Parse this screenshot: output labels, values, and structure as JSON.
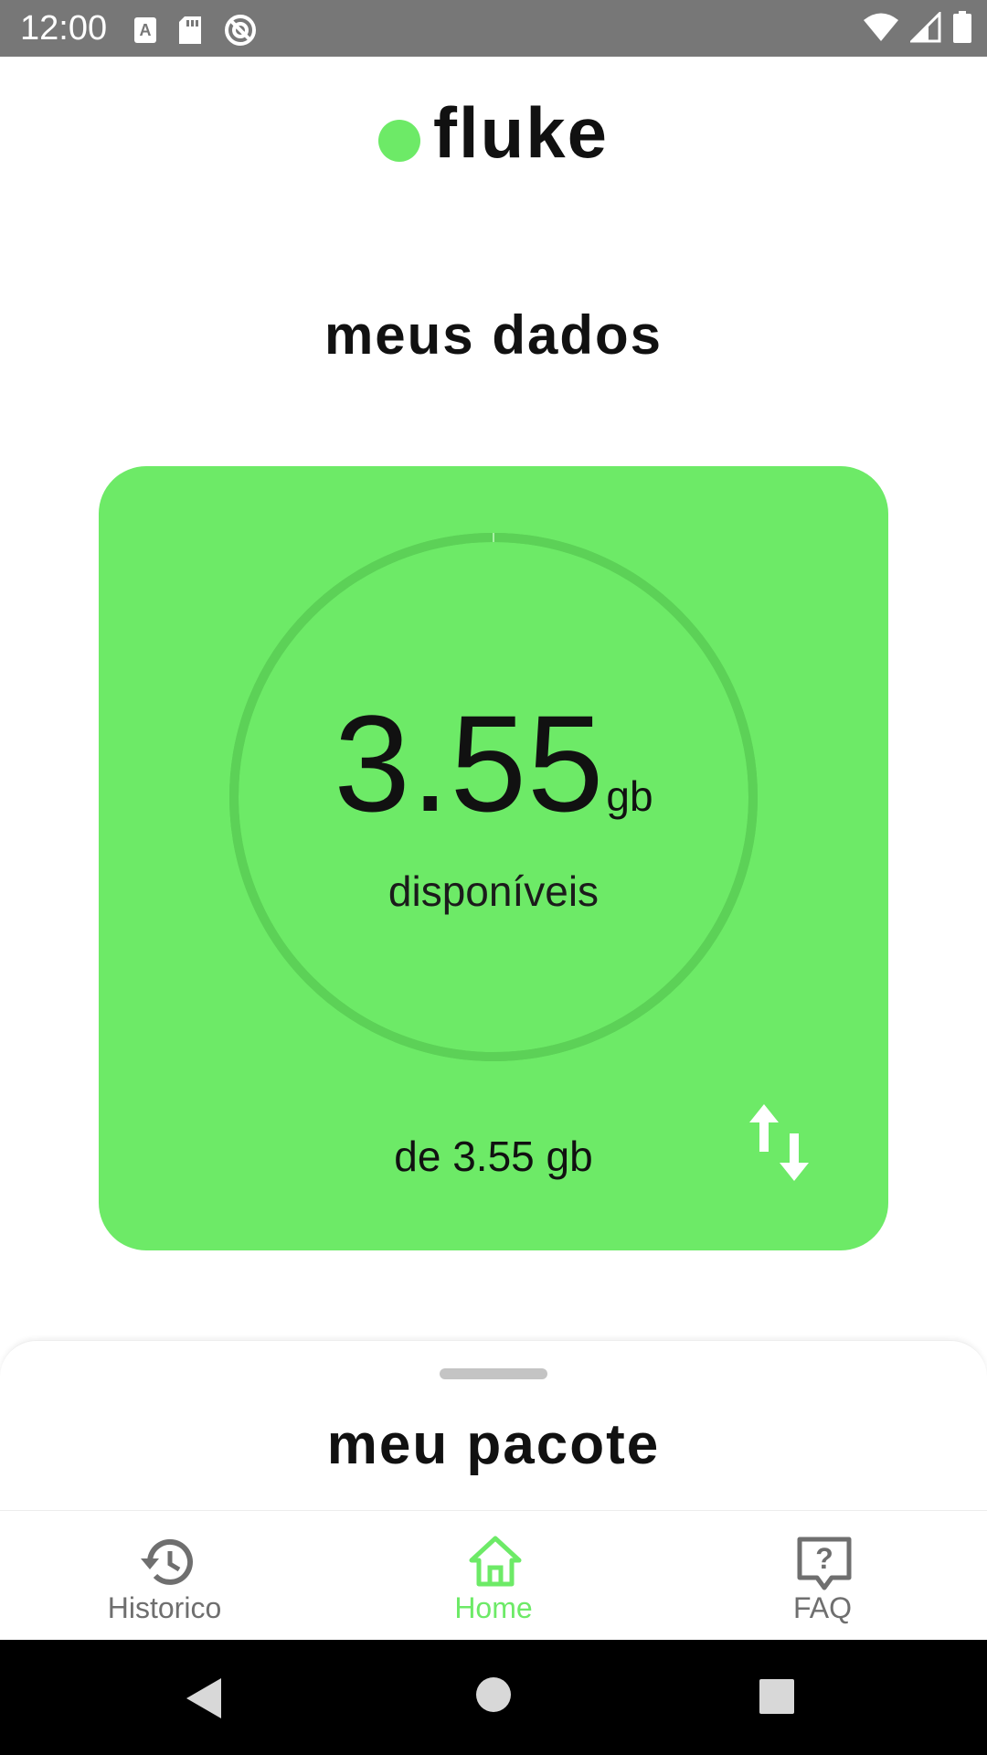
{
  "status_bar": {
    "time": "12:00",
    "icons": [
      "keyboard-a-icon",
      "sd-card-icon",
      "no-sync-icon",
      "wifi-icon",
      "signal-icon",
      "battery-icon"
    ]
  },
  "logo": {
    "text": "fluke"
  },
  "page": {
    "title": "meus dados"
  },
  "data_card": {
    "value": "3.55",
    "unit": "gb",
    "label": "disponíveis",
    "total": "de 3.55 gb",
    "remaining_fraction": 1.0,
    "icon": "transfer-arrows-icon"
  },
  "bottom_sheet": {
    "title": "meu pacote"
  },
  "bottom_nav": {
    "items": [
      {
        "label": "Historico",
        "icon": "history-icon",
        "active": false
      },
      {
        "label": "Home",
        "icon": "home-icon",
        "active": true
      },
      {
        "label": "FAQ",
        "icon": "faq-icon",
        "active": false
      }
    ]
  },
  "system_nav": {
    "icons": [
      "back-icon",
      "home-circle-icon",
      "recents-icon"
    ]
  },
  "colors": {
    "accent": "#6dea67",
    "ring": "#5cd157",
    "status_bar": "#777777",
    "nav_inactive": "#6f6f6f"
  }
}
